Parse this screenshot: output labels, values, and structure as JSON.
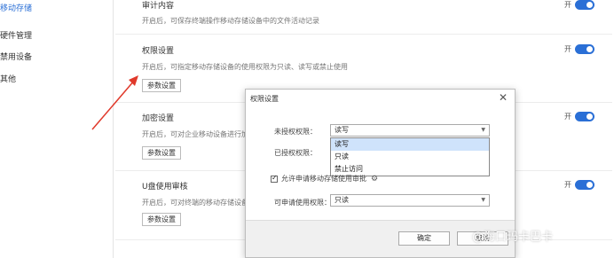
{
  "sidebar": {
    "items": [
      {
        "label": "移动存储",
        "active": true
      },
      {
        "label": "硬件管理",
        "active": false
      },
      {
        "label": "禁用设备",
        "active": false
      },
      {
        "label": "其他",
        "active": false
      }
    ]
  },
  "sections": [
    {
      "title": "审计内容",
      "desc": "开启后，可保存终端操作移动存储设备中的文件活动记录",
      "toggle_label": "开",
      "toggle_on": true
    },
    {
      "title": "权限设置",
      "desc": "开启后，可指定移动存储设备的使用权限为只读、读写或禁止使用",
      "button": "参数设置",
      "toggle_label": "开",
      "toggle_on": true
    },
    {
      "title": "加密设置",
      "desc": "开启后，可对企业移动设备进行加",
      "button": "参数设置",
      "toggle_label": "开",
      "toggle_on": true
    },
    {
      "title": "U盘使用审核",
      "desc": "开启后，可对终端的移动存储设备",
      "button": "参数设置",
      "toggle_label": "开",
      "toggle_on": true
    }
  ],
  "dialog": {
    "title": "权限设置",
    "close": "✕",
    "unauthorized_label": "未授权权限：",
    "unauthorized_value": "读写",
    "authorized_label": "已授权权限：",
    "dropdown_options": [
      {
        "label": "读写",
        "selected": true
      },
      {
        "label": "只读",
        "selected": false
      },
      {
        "label": "禁止访问",
        "selected": false
      }
    ],
    "checkbox_label": "允许申请移动存储使用审批",
    "checkbox_checked": true,
    "request_label": "可申请使用权限：",
    "request_value": "只读",
    "ok_label": "确定",
    "cancel_label": "取消"
  },
  "watermark": "@海口玛卡巴卡",
  "colors": {
    "accent": "#2a6fd6",
    "annotation_arrow": "#e0392b"
  }
}
